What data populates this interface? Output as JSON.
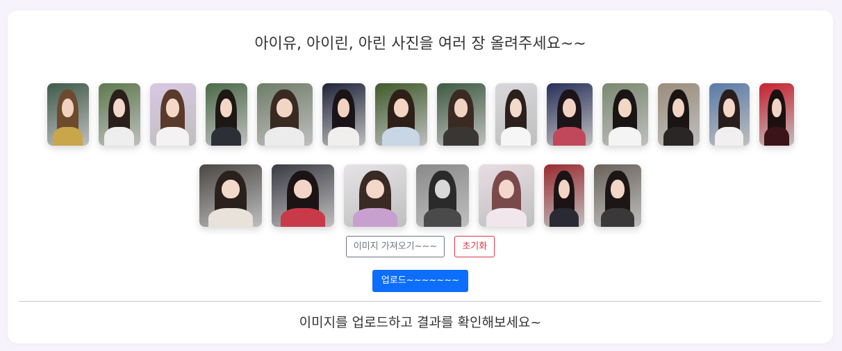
{
  "header": {
    "title": "아이유, 아이린, 아린 사진을 여러 장 올려주세요~~"
  },
  "thumbnails_row1": [
    {
      "w": 60,
      "bg": "#3e5a4a",
      "hair": "#6b4a2e",
      "face": "#f1d2bf",
      "body": "#c9a64a"
    },
    {
      "w": 60,
      "bg": "#5d7a4d",
      "hair": "#2a1f1a",
      "face": "#f3d9c9",
      "body": "#eeeeee"
    },
    {
      "w": 66,
      "bg": "#d9c7e3",
      "hair": "#5a3a2a",
      "face": "#f4d8c8",
      "body": "#f4f2f2"
    },
    {
      "w": 60,
      "bg": "#4b6a48",
      "hair": "#1e1814",
      "face": "#f3d8c6",
      "body": "#2d2f36"
    },
    {
      "w": 80,
      "bg": "#6f7d68",
      "hair": "#3a2a22",
      "face": "#f2d6c4",
      "body": "#ececec"
    },
    {
      "w": 62,
      "bg": "#1f2438",
      "hair": "#1a1418",
      "face": "#f2d3c2",
      "body": "#f1eeee"
    },
    {
      "w": 75,
      "bg": "#3f5a2a",
      "hair": "#2e2018",
      "face": "#f2d5c3",
      "body": "#c9d6e6"
    },
    {
      "w": 70,
      "bg": "#3d5a40",
      "hair": "#3b2a22",
      "face": "#f1d3c1",
      "body": "#3a3634"
    },
    {
      "w": 60,
      "bg": "#d8d8dc",
      "hair": "#2b201c",
      "face": "#f3dacb",
      "body": "#f6f6f6"
    },
    {
      "w": 66,
      "bg": "#27305a",
      "hair": "#1c1418",
      "face": "#f1d2c2",
      "body": "#c0485a"
    },
    {
      "w": 66,
      "bg": "#7b8870",
      "hair": "#1a1414",
      "face": "#f2d6c6",
      "body": "#f4f4f4"
    },
    {
      "w": 60,
      "bg": "#9a8d7c",
      "hair": "#1a1414",
      "face": "#f1d4c4",
      "body": "#2a2626"
    },
    {
      "w": 58,
      "bg": "#5a7aa8",
      "hair": "#2a1e1c",
      "face": "#f3d8c8",
      "body": "#f1efef"
    },
    {
      "w": 50,
      "bg": "#c8202e",
      "hair": "#1a1010",
      "face": "#f2d4c4",
      "body": "#3a1418"
    }
  ],
  "thumbnails_row2": [
    {
      "w": 90,
      "bg": "#4a4642",
      "hair": "#2a201c",
      "face": "#f3d9ca",
      "body": "#e8e2da"
    },
    {
      "w": 90,
      "bg": "#3a3a44",
      "hair": "#1c1414",
      "face": "#f2d5c6",
      "body": "#c83a4a"
    },
    {
      "w": 90,
      "bg": "#e6e3e6",
      "hair": "#3a2a24",
      "face": "#f3d7c8",
      "body": "#c8a0d0"
    },
    {
      "w": 76,
      "bg": "#8a8a8a",
      "hair": "#2a2a2a",
      "face": "#d8d8d8",
      "body": "#4a4a4a"
    },
    {
      "w": 80,
      "bg": "#e8dde3",
      "hair": "#7a4a4a",
      "face": "#f3d6cc",
      "body": "#f1e6ec"
    },
    {
      "w": 58,
      "bg": "#9a2a30",
      "hair": "#1c1414",
      "face": "#f2d4c4",
      "body": "#2a2a34"
    },
    {
      "w": 68,
      "bg": "#6a625a",
      "hair": "#1c1616",
      "face": "#f2d6c6",
      "body": "#3a3838"
    }
  ],
  "controls": {
    "load_label": "이미지 가져오기~~~",
    "reset_label": "초기화",
    "upload_label": "업로드~~~~~~~"
  },
  "result": {
    "message": "이미지를 업로드하고 결과를 확인해보세요~"
  },
  "colors": {
    "page_bg": "#f7f3fc",
    "primary": "#0d6efd",
    "danger": "#dc3545",
    "secondary": "#6c757d"
  }
}
